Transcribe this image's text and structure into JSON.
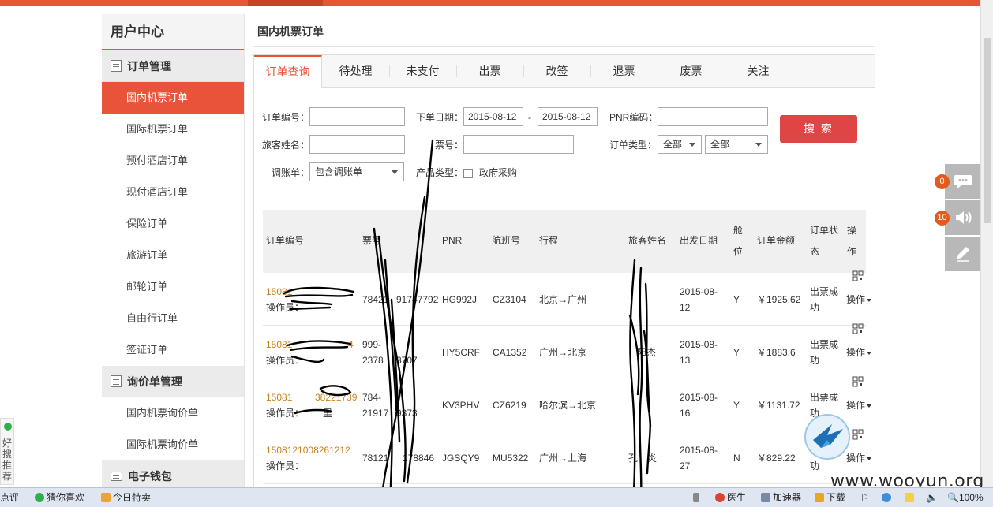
{
  "sidebar": {
    "title": "用户中心",
    "group_orders": "订单管理",
    "items": [
      "国内机票订单",
      "国际机票订单",
      "预付酒店订单",
      "现付酒店订单",
      "保险订单",
      "旅游订单",
      "邮轮订单",
      "自由行订单",
      "签证订单"
    ],
    "group_inquiry": "询价单管理",
    "inquiry_items": [
      "国内机票询价单",
      "国际机票询价单"
    ],
    "group_wallet": "电子钱包"
  },
  "page": {
    "title": "国内机票订单"
  },
  "tabs": [
    "订单查询",
    "待处理",
    "未支付",
    "出票",
    "改签",
    "退票",
    "废票",
    "关注"
  ],
  "form": {
    "order_no_label": "订单编号：",
    "date_label": "下单日期：",
    "date_from": "2015-08-12",
    "date_sep": "-",
    "date_to": "2015-08-12",
    "pnr_label": "PNR编码：",
    "passenger_label": "旅客姓名：",
    "ticket_label": "票号：",
    "order_type_label": "订单类型：",
    "order_type_1": "全部",
    "order_type_2": "全部",
    "adjust_label": "调账单：",
    "adjust_value": "包含调账单",
    "product_label": "产品类型：",
    "product_option": "政府采购",
    "search_button": "搜 索"
  },
  "table": {
    "headers": [
      "订单编号",
      "票号",
      "PNR",
      "航班号",
      "行程",
      "旅客姓名",
      "出发日期",
      "舱",
      "位",
      "订单金额",
      "订单状",
      "态",
      "操",
      "作"
    ],
    "rows": [
      {
        "order": "15081",
        "operator": "操作员：",
        "ticket_a": "78421",
        "ticket_b": "91747792",
        "pnr": "HG992J",
        "flight": "CZ3104",
        "route": "北京→广州",
        "date_a": "2015-08-",
        "date_b": "12",
        "cabin": "Y",
        "amount": "￥1925.62",
        "status_a": "出票成",
        "status_b": "功",
        "op": "操作"
      },
      {
        "order": "15081",
        "order_tail": "4",
        "operator": "操作员：",
        "ticket_a": "999-",
        "ticket_b": "2378",
        "ticket_c": "8707",
        "pnr": "HY5CRF",
        "flight": "CA1352",
        "route": "广州→北京",
        "passenger": "阳杰",
        "date_a": "2015-08-",
        "date_b": "13",
        "cabin": "Y",
        "amount": "￥1883.6",
        "status_a": "出票成",
        "status_b": "功",
        "op": "操作"
      },
      {
        "order": "15081",
        "order_tail": "38221739",
        "operator": "操作员：",
        "operator_tail": "里",
        "ticket_a": "784-",
        "ticket_b": "21917",
        "ticket_c": "9373",
        "pnr": "KV3PHV",
        "flight": "CZ6219",
        "route": "哈尔滨→北京",
        "date_a": "2015-08-",
        "date_b": "16",
        "cabin": "Y",
        "amount": "￥1131.72",
        "status_a": "出票成",
        "status_b": "功",
        "op": "操作"
      },
      {
        "order": "1508121008261212",
        "operator": "操作员：",
        "ticket": "78121",
        "ticket_tail": "178846",
        "pnr": "JGSQY9",
        "flight": "MU5322",
        "route": "广州→上海",
        "passenger": "孔",
        "passenger_tail": "炎",
        "date_a": "2015-08-",
        "date_b": "27",
        "cabin": "N",
        "amount": "￥829.22",
        "status_a": "出票成",
        "status_b": "功",
        "op": "操作"
      }
    ]
  },
  "float_badges": {
    "messages": "0",
    "notices": "10"
  },
  "left_float": {
    "label": "好搜推荐"
  },
  "taskbar": {
    "item_left": "点评",
    "guess": "猜你喜欢",
    "today": "今日特卖",
    "doctor": "医生",
    "accelerator": "加速器",
    "download": "下载",
    "zoom": "100%"
  },
  "watermark": "www.wooyun.org",
  "colors": {
    "accent": "#e8543a",
    "search_button": "#e04545",
    "order_link": "#c8821f",
    "badge": "#e25a1c"
  }
}
